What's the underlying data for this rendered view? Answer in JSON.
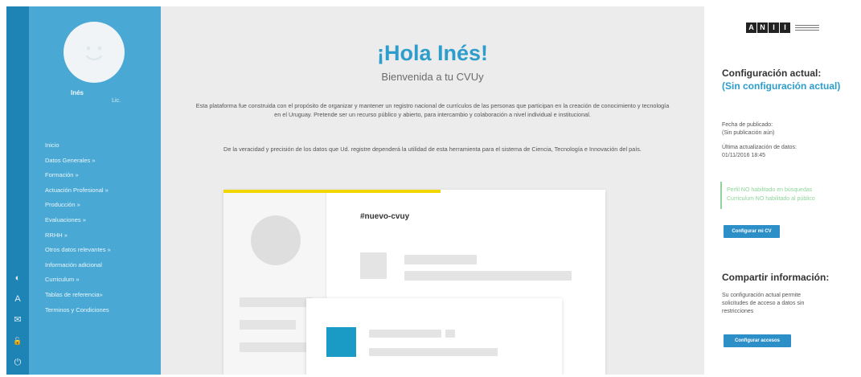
{
  "rail": {
    "icons": [
      {
        "name": "contrast-icon",
        "glyph": "◐"
      },
      {
        "name": "font-size-icon",
        "glyph": "A"
      },
      {
        "name": "mail-icon",
        "glyph": "✉"
      },
      {
        "name": "lock-icon",
        "glyph": "🔓"
      },
      {
        "name": "power-icon",
        "glyph": "⏻"
      }
    ]
  },
  "user": {
    "name": "Inés",
    "subtitle": "Lic."
  },
  "sidebar": {
    "items": [
      {
        "label": "Inicio"
      },
      {
        "label": "Datos Generales »"
      },
      {
        "label": "Formación »"
      },
      {
        "label": "Actuación Profesional »"
      },
      {
        "label": "Producción »"
      },
      {
        "label": "Evaluaciones »"
      },
      {
        "label": "RRHH »"
      },
      {
        "label": "Otros datos relevantes »"
      },
      {
        "label": "Información adicional"
      },
      {
        "label": "Curriculum »"
      },
      {
        "label": "Tablas de referencia»"
      },
      {
        "label": "Terminos y Condiciones"
      }
    ]
  },
  "main": {
    "greeting": "¡Hola Inés!",
    "welcome": "Bienvenida a tu CVUy",
    "intro": "Esta plataforma fue construida con el propósito de organizar y mantener un registro nacional de currículos de las personas que participan en la creación de conocimiento y tecnología en el Uruguay. Pretende ser un recurso público y abierto, para intercambio y colaboración a nivel individual e institucional.",
    "intro2": "De la veracidad y precisión de los datos que Ud. registre dependerá la utilidad de esta herramienta para el sistema de Ciencia, Tecnología e Innovación del país.",
    "mock_title": "#nuevo-cvuy"
  },
  "right": {
    "logo_letters": [
      "A",
      "N",
      "I",
      "I"
    ],
    "config_title": "Configuración actual:",
    "config_value": "(Sin configuración actual)",
    "published_label": "Fecha de publicado:",
    "published_value": "(Sin publicación aún)",
    "updated_label": "Última actualización de datos:",
    "updated_value": "01/11/2016 18:45",
    "alert_line1": "Perfil NO habilitado en búsquedas",
    "alert_line2": "Curriculum NO habilitado al público",
    "configure_button": "Configurar mi CV",
    "share_title": "Compartir información:",
    "share_text": "Su configuración actual permite solicitudes de acceso a datos sin restricciones",
    "access_button": "Configurar accesos"
  },
  "colors": {
    "rail": "#1e84b6",
    "sidebar": "#4aa9d4",
    "accent": "#2d9dcc",
    "highlight_bar": "#f1d600",
    "success": "#8fd49a"
  }
}
